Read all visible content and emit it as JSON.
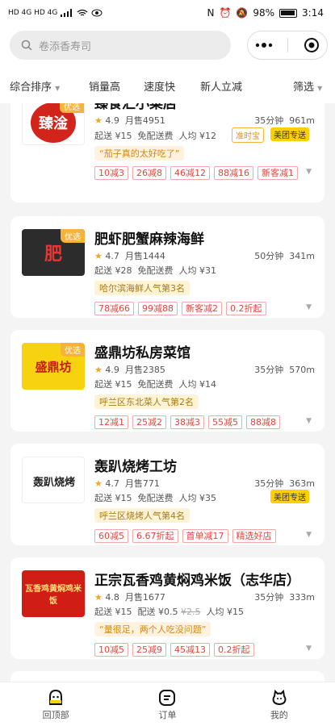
{
  "status": {
    "left": "HD 4G HD 4G",
    "battery": "98%",
    "time": "3:14"
  },
  "search": {
    "placeholder": "卷添香寿司"
  },
  "filters": [
    "综合排序",
    "销量高",
    "速度快",
    "新人立减",
    "筛选"
  ],
  "stores": [
    {
      "name": "臻食汇小菜店",
      "logo_text": "臻淦",
      "rating": "4.9",
      "monthly": "月售4951",
      "time": "35分钟",
      "dist": "961m",
      "min": "起送 ¥15",
      "delivery": "免配送费",
      "per": "人均 ¥12",
      "dtags": [
        "准时宝",
        "美团专送"
      ],
      "quote": "“茄子真的太好吃了”",
      "tags": [
        "10减3",
        "26减8",
        "46减12",
        "88减16",
        "新客减1"
      ]
    },
    {
      "name": "肥虾肥蟹麻辣海鲜",
      "logo_text": "肥",
      "rating": "4.7",
      "monthly": "月售1444",
      "time": "50分钟",
      "dist": "341m",
      "min": "起送 ¥28",
      "delivery": "免配送费",
      "per": "人均 ¥31",
      "badge": "优选",
      "rank": "哈尔滨海鲜人气第3名",
      "tags": [
        "78减66",
        "99减88",
        "新客减2",
        "0.2折起"
      ]
    },
    {
      "name": "盛鼎坊私房菜馆",
      "logo_text": "盛鼎坊",
      "rating": "4.9",
      "monthly": "月售2385",
      "time": "35分钟",
      "dist": "570m",
      "min": "起送 ¥15",
      "delivery": "免配送费",
      "per": "人均 ¥14",
      "badge": "优选",
      "rank": "呼兰区东北菜人气第2名",
      "tags": [
        "12减1",
        "25减2",
        "38减3",
        "55减5",
        "88减8"
      ]
    },
    {
      "name": "轰趴烧烤工坊",
      "logo_text": "轰趴烧烤",
      "rating": "4.7",
      "monthly": "月售771",
      "time": "35分钟",
      "dist": "363m",
      "min": "起送 ¥15",
      "delivery": "免配送费",
      "per": "人均 ¥35",
      "dtag": "美团专送",
      "rank": "呼兰区烧烤人气第4名",
      "tags": [
        "60减5",
        "6.67折起",
        "首单减17",
        "精选好店"
      ]
    },
    {
      "name": "正宗瓦香鸡黄焖鸡米饭（志华店）",
      "logo_text": "瓦香鸡黄焖鸡米饭",
      "rating": "4.8",
      "monthly": "月售1677",
      "time": "35分钟",
      "dist": "333m",
      "min": "起送 ¥15",
      "delivery": "配送 ¥0.5",
      "old_fee": "¥2.5",
      "per": "人均 ¥15",
      "quote": "“量很足，两个人吃没问题”",
      "tags": [
        "10减5",
        "25减9",
        "45减13",
        "0.2折起"
      ]
    }
  ],
  "nav": [
    "回顶部",
    "订单",
    "我的"
  ],
  "colors": {
    "accent": "#ffd000",
    "tag": "#e1473d",
    "star": "#f5a623"
  }
}
